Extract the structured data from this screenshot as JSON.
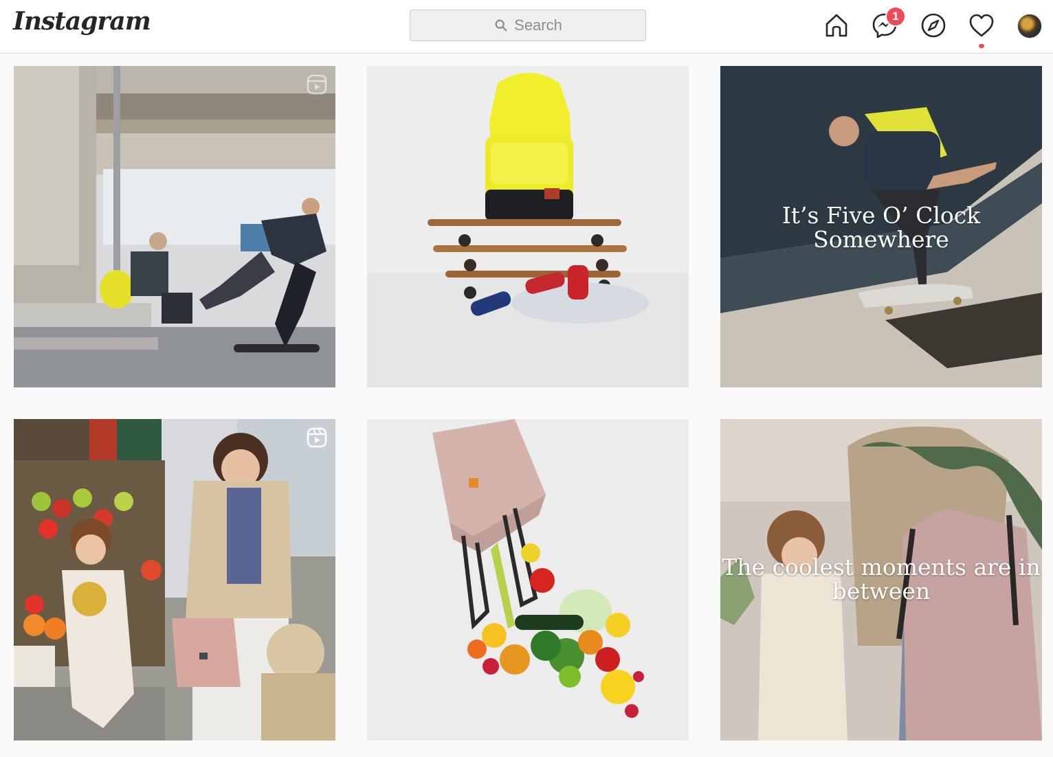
{
  "app": {
    "logo": "Instagram"
  },
  "search": {
    "placeholder": "Search"
  },
  "nav": {
    "messages_badge": "1"
  },
  "colors": {
    "badge": "#ed4956",
    "border": "#dbdbdb",
    "background": "#fafafa"
  },
  "posts": [
    {
      "kind": "photo",
      "subject": "skateboarder-under-overpass",
      "overlay": "",
      "reel": true
    },
    {
      "kind": "photo",
      "subject": "yellow-backpack-on-skateboards",
      "overlay": "",
      "reel": false
    },
    {
      "kind": "photo",
      "subject": "skateboarder-with-backpack",
      "overlay": "It’s Five O’ Clock Somewhere",
      "reel": false
    },
    {
      "kind": "photo",
      "subject": "market-mother-and-child",
      "overlay": "",
      "reel": true
    },
    {
      "kind": "photo",
      "subject": "pink-tote-with-vegetables",
      "overlay": "",
      "reel": false
    },
    {
      "kind": "photo",
      "subject": "mother-and-child-walking",
      "overlay": "The coolest moments are in between",
      "reel": false
    }
  ]
}
